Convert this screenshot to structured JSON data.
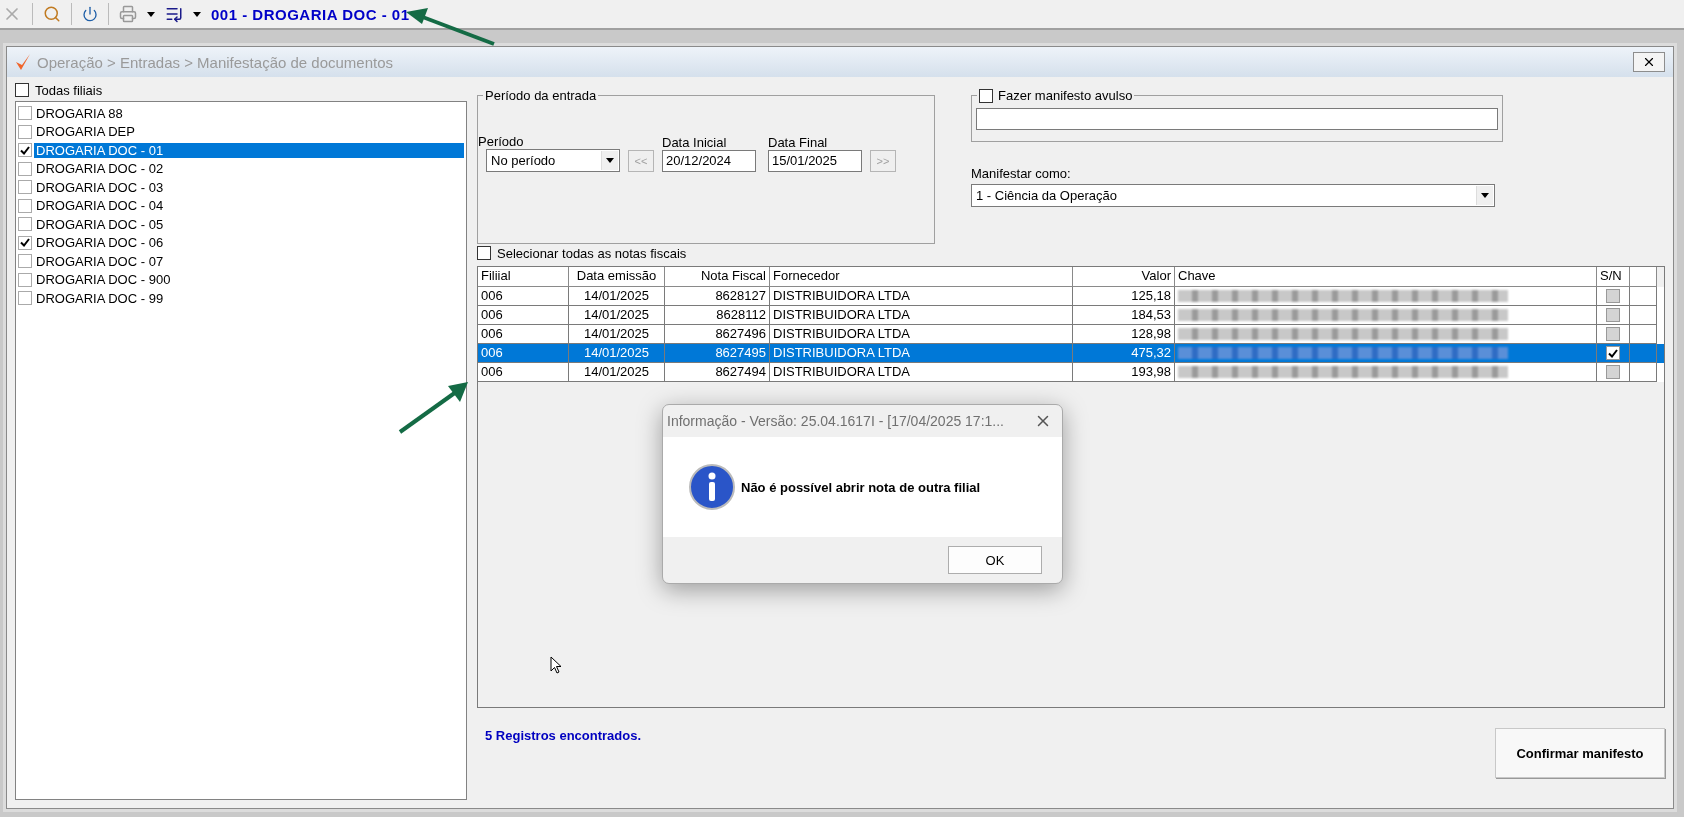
{
  "toolbar": {
    "company": "001 - DROGARIA DOC - 01"
  },
  "window": {
    "title": "Operação > Entradas > Manifestação de documentos"
  },
  "branches": {
    "all_label": "Todas filiais",
    "all_checked": false,
    "items": [
      {
        "label": "DROGARIA 88",
        "checked": false,
        "selected": false
      },
      {
        "label": "DROGARIA DEP",
        "checked": false,
        "selected": false
      },
      {
        "label": "DROGARIA DOC - 01",
        "checked": true,
        "selected": true
      },
      {
        "label": "DROGARIA DOC - 02",
        "checked": false,
        "selected": false
      },
      {
        "label": "DROGARIA DOC - 03",
        "checked": false,
        "selected": false
      },
      {
        "label": "DROGARIA DOC - 04",
        "checked": false,
        "selected": false
      },
      {
        "label": "DROGARIA DOC - 05",
        "checked": false,
        "selected": false
      },
      {
        "label": "DROGARIA DOC - 06",
        "checked": true,
        "selected": false
      },
      {
        "label": "DROGARIA DOC - 07",
        "checked": false,
        "selected": false
      },
      {
        "label": "DROGARIA DOC - 900",
        "checked": false,
        "selected": false
      },
      {
        "label": "DROGARIA DOC - 99",
        "checked": false,
        "selected": false
      }
    ]
  },
  "period": {
    "title": "Período da entrada",
    "period_label": "Período",
    "period_value": "No período",
    "prev": "<<",
    "start_label": "Data Inicial",
    "start_value": "20/12/2024",
    "end_label": "Data Final",
    "end_value": "15/01/2025",
    "next": ">>"
  },
  "manifest_single": {
    "label": "Fazer manifesto avulso",
    "checked": false
  },
  "manifest_as": {
    "label": "Manifestar como:",
    "value": "1 - Ciência da Operação"
  },
  "select_all": {
    "label": "Selecionar todas as notas fiscais",
    "checked": false
  },
  "table": {
    "columns": [
      "Filiial",
      "Data emissão",
      "Nota Fiscal",
      "Fornecedor",
      "Valor",
      "Chave",
      "S/N"
    ],
    "rows": [
      {
        "cells": [
          "006",
          "14/01/2025",
          "8628127",
          "DISTRIBUIDORA  LTDA",
          "125,18"
        ],
        "checked": false,
        "selected": false
      },
      {
        "cells": [
          "006",
          "14/01/2025",
          "8628112",
          "DISTRIBUIDORA  LTDA",
          "184,53"
        ],
        "checked": false,
        "selected": false
      },
      {
        "cells": [
          "006",
          "14/01/2025",
          "8627496",
          "DISTRIBUIDORA  LTDA",
          "128,98"
        ],
        "checked": false,
        "selected": false
      },
      {
        "cells": [
          "006",
          "14/01/2025",
          "8627495",
          "DISTRIBUIDORA  LTDA",
          "475,32"
        ],
        "checked": true,
        "selected": true
      },
      {
        "cells": [
          "006",
          "14/01/2025",
          "8627494",
          "DISTRIBUIDORA  LTDA",
          "193,98"
        ],
        "checked": false,
        "selected": false
      }
    ]
  },
  "footer": {
    "records": "5 Registros encontrados.",
    "confirm": "Confirmar manifesto"
  },
  "dialog": {
    "title": "Informação - Versão: 25.04.1617I - [17/04/2025 17:1...",
    "message": "Não é possível abrir nota de outra filial",
    "ok": "OK"
  }
}
